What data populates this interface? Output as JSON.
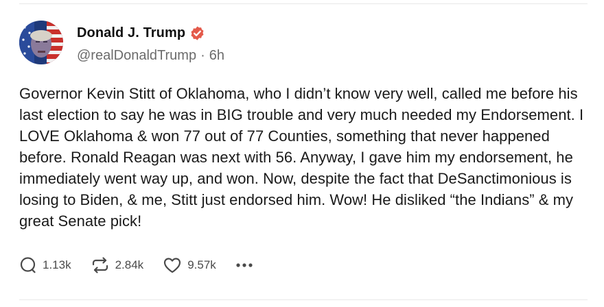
{
  "post": {
    "author": {
      "display_name": "Donald J. Trump",
      "handle": "@realDonaldTrump",
      "separator": "·",
      "time_ago": "6h",
      "verified": true,
      "avatar_icon": "avatar-flag-portrait"
    },
    "body": "Governor Kevin Stitt of Oklahoma, who I didn’t know very well, called me before his last election to say he was in BIG trouble and very much needed my Endorsement. I LOVE Oklahoma & won 77 out of 77 Counties, something that never happened before. Ronald Reagan was next with 56. Anyway, I gave him my endorsement, he immediately went way up, and won. Now, despite the fact that DeSanctimonious is losing to Biden, & me, Stitt just endorsed him. Wow! He disliked “the Indians” & my great Senate pick!",
    "actions": {
      "reply": {
        "icon": "reply-icon",
        "count": "1.13k"
      },
      "retruth": {
        "icon": "retruth-icon",
        "count": "2.84k"
      },
      "like": {
        "icon": "heart-icon",
        "count": "9.57k"
      },
      "more": {
        "icon": "more-icon"
      }
    }
  },
  "colors": {
    "verified_badge": "#e45a4b",
    "text_primary": "#111111",
    "text_secondary": "#6b6b6b",
    "icon": "#4a4a4a",
    "divider": "#e8e8e8"
  }
}
